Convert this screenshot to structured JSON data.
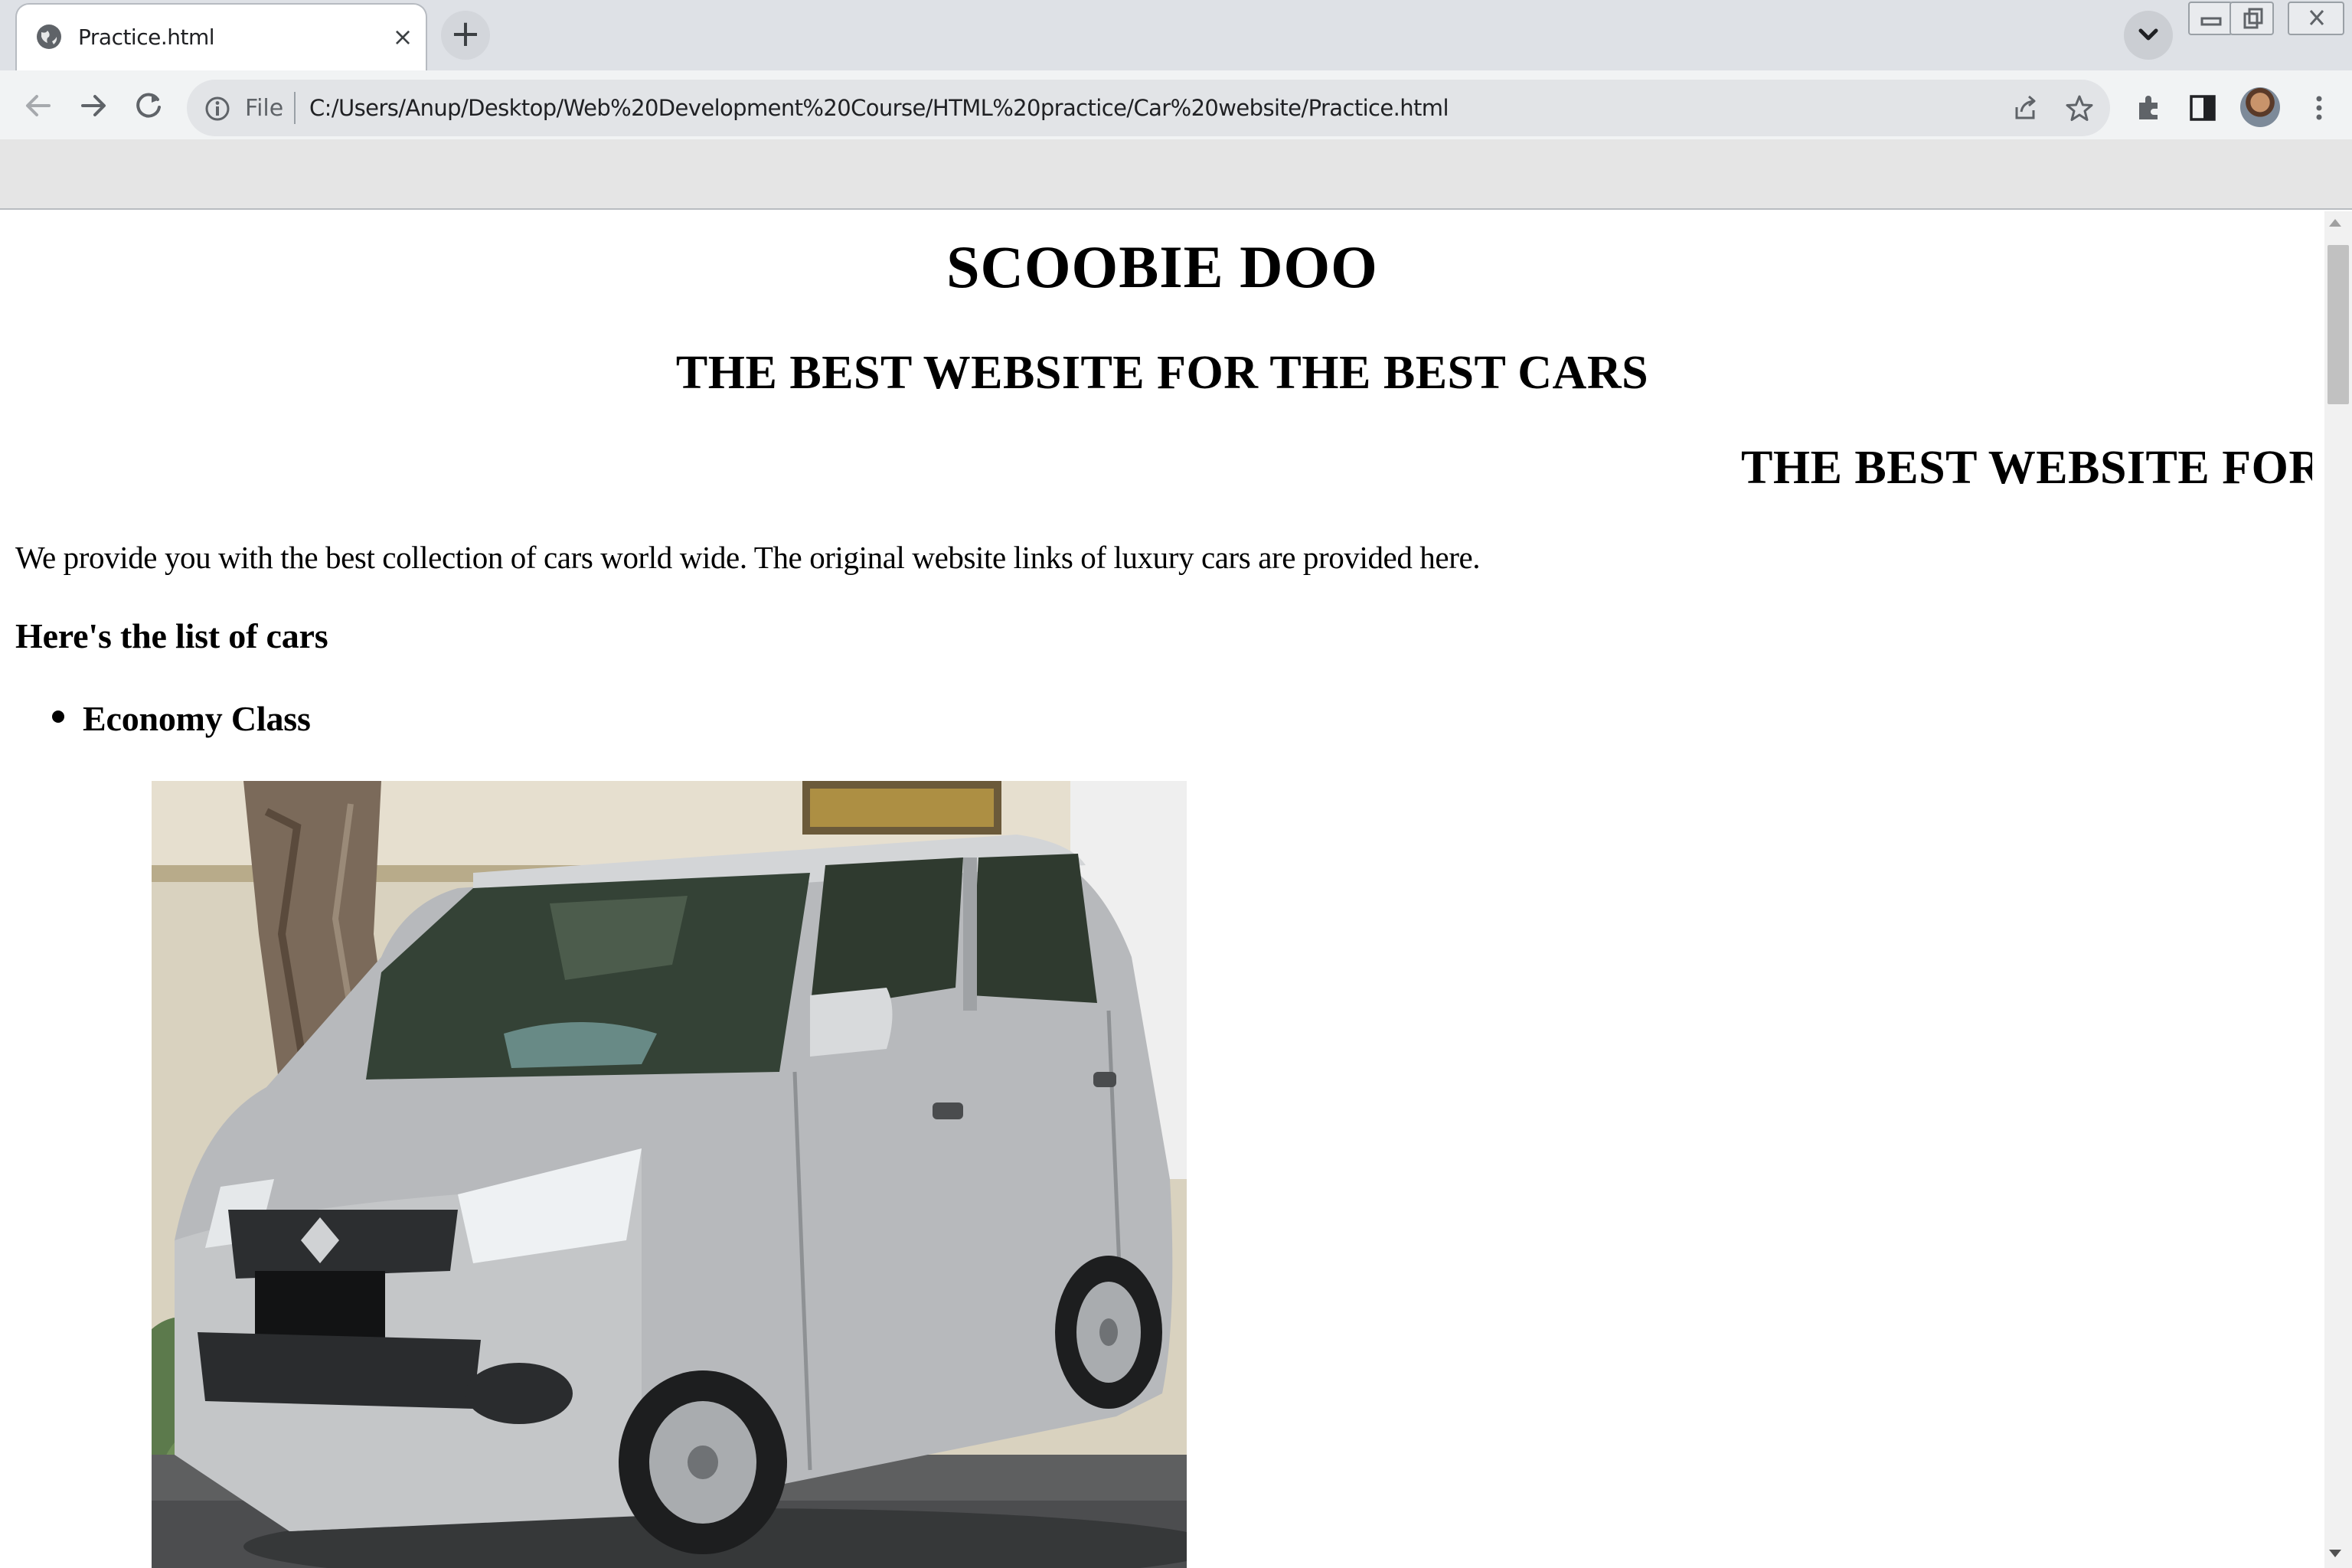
{
  "browser": {
    "tab": {
      "title": "Practice.html",
      "close": "×"
    },
    "new_tab": "+",
    "omnibox": {
      "scheme_label": "File",
      "url": "C:/Users/Anup/Desktop/Web%20Development%20Course/HTML%20practice/Car%20website/Practice.html"
    }
  },
  "page": {
    "title": "SCOOBIE DOO",
    "tagline": "THE BEST WEBSITE FOR THE BEST CARS",
    "marquee_text": "THE BEST WEBSITE FOR TH",
    "intro": "We provide you with the best collection of cars world wide. The original website links of luxury cars are provided here.",
    "list_heading": "Here's the list of cars",
    "list_items": [
      "Economy Class"
    ]
  },
  "colors": {
    "chrome_bg": "#dee1e6",
    "toolbar_bg": "#f1f3f4",
    "omnibox_bg": "#e2e4e7",
    "page_bg": "#ffffff",
    "text": "#000000"
  }
}
